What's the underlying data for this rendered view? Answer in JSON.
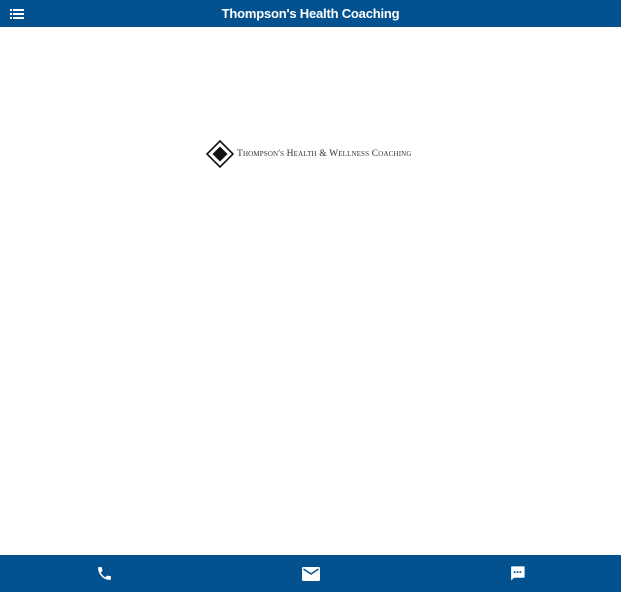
{
  "header": {
    "title": "Thompson's Health Coaching",
    "menu_icon": "menu-list-icon"
  },
  "main": {
    "logo": {
      "icon": "diamond-logo-icon",
      "text": "Thompson's Health & Wellness Coaching"
    }
  },
  "bottom_bar": {
    "actions": [
      {
        "id": "call",
        "icon": "phone-icon"
      },
      {
        "id": "email",
        "icon": "mail-icon"
      },
      {
        "id": "message",
        "icon": "chat-icon"
      }
    ]
  },
  "colors": {
    "bar": "#03528f",
    "background": "#ffffff",
    "icon": "#ffffff"
  }
}
